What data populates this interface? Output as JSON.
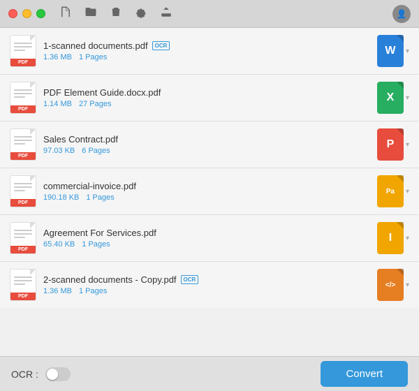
{
  "titleBar": {
    "trafficLights": [
      "red",
      "yellow",
      "green"
    ]
  },
  "toolbar": {
    "icons": [
      "new-file",
      "open-folder",
      "delete",
      "settings",
      "upload"
    ]
  },
  "files": [
    {
      "name": "1-scanned documents.pdf",
      "ocr": true,
      "size": "1.36 MB",
      "pages": "1 Pages",
      "outputType": "word",
      "outputLabel": "W",
      "outputColor": "#2980d9"
    },
    {
      "name": "PDF Element Guide.docx.pdf",
      "ocr": false,
      "size": "1.14 MB",
      "pages": "27 Pages",
      "outputType": "excel",
      "outputLabel": "X",
      "outputColor": "#27ae60"
    },
    {
      "name": "Sales Contract.pdf",
      "ocr": false,
      "size": "97.03 KB",
      "pages": "6 Pages",
      "outputType": "ppt",
      "outputLabel": "P",
      "outputColor": "#e74c3c"
    },
    {
      "name": "commercial-invoice.pdf",
      "ocr": false,
      "size": "190.18 KB",
      "pages": "1 Pages",
      "outputType": "pages",
      "outputLabel": "Pa",
      "outputColor": "#f0a500"
    },
    {
      "name": "Agreement For Services.pdf",
      "ocr": false,
      "size": "65.40 KB",
      "pages": "1 Pages",
      "outputType": "iwork",
      "outputLabel": "I",
      "outputColor": "#f0a500"
    },
    {
      "name": "2-scanned documents - Copy.pdf",
      "ocr": true,
      "size": "1.36 MB",
      "pages": "1 Pages",
      "outputType": "code",
      "outputLabel": "</>",
      "outputColor": "#e67e22"
    }
  ],
  "bottomBar": {
    "ocrLabel": "OCR :",
    "convertLabel": "Convert"
  }
}
